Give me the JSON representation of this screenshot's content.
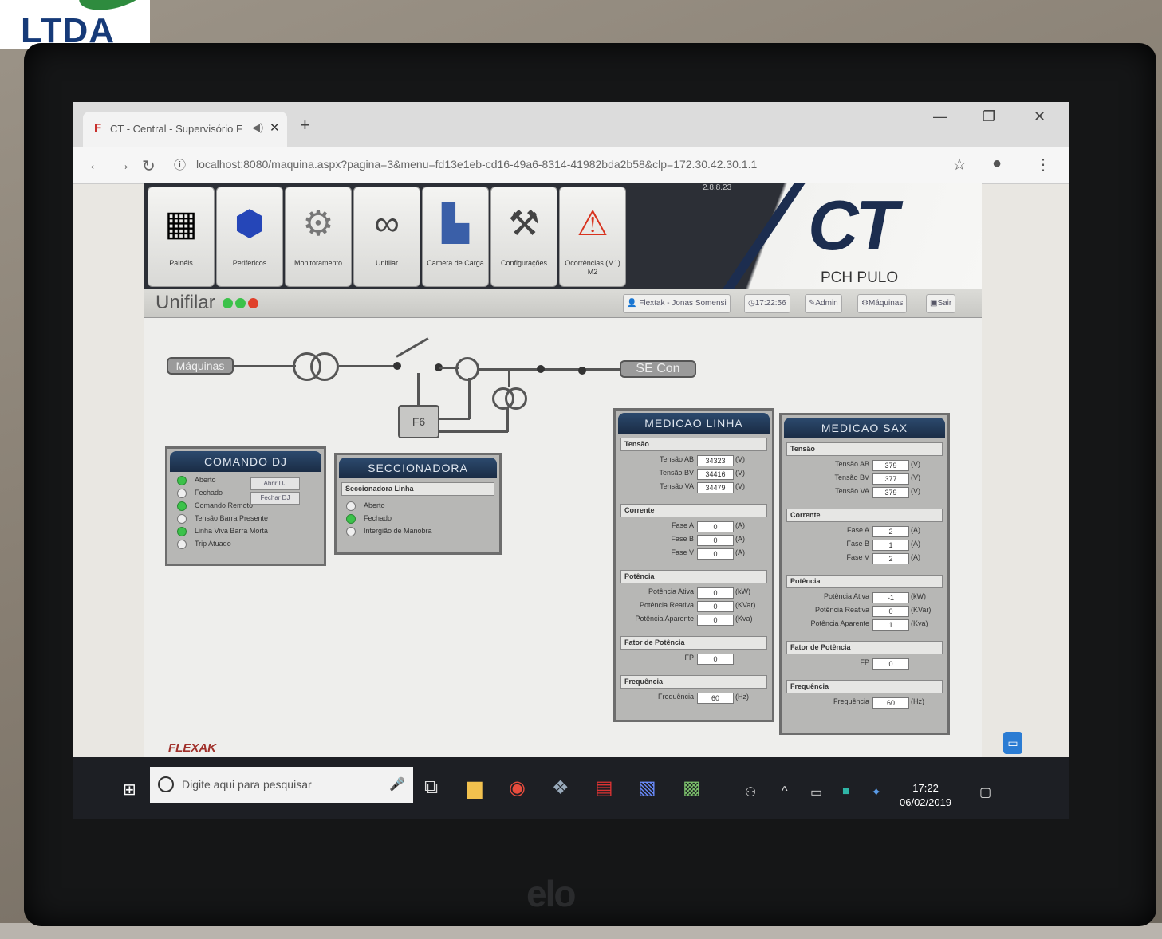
{
  "browser": {
    "tab_title": "CT - Central - Supervisório F",
    "url": "localhost:8080/maquina.aspx?pagina=3&menu=fd13e1eb-cd16-49a6-8314-41982bda2b58&clp=172.30.42.30.1.1"
  },
  "watermark": {
    "text": "LTDA"
  },
  "app": {
    "version": "2.8.8.23",
    "brand": "CT",
    "site": "PCH PULO",
    "page_title": "Unifilar",
    "toolbar": [
      {
        "label": "Painéis",
        "icon": "panel-icon"
      },
      {
        "label": "Periféricos",
        "icon": "pump-icon"
      },
      {
        "label": "Monitoramento",
        "icon": "gear-icon"
      },
      {
        "label": "Unifilar",
        "icon": "transformer-icon"
      },
      {
        "label": "Camera de Carga",
        "icon": "machine-icon"
      },
      {
        "label": "Configurações",
        "icon": "tools-icon"
      },
      {
        "label": "Ocorrências (M1) M2",
        "icon": "alarm-icon"
      }
    ],
    "status_dots": [
      "#3cc24a",
      "#3cc24a",
      "#e0402a"
    ],
    "user": "Flextak - Jonas Somensi",
    "time": "17:22:56",
    "buttons": {
      "admin": "Admin",
      "machines": "Máquinas",
      "exit": "Sair"
    }
  },
  "diagram": {
    "left_label": "Máquinas",
    "right_label": "SE Con",
    "box_label": "F6"
  },
  "comando_dj": {
    "title": "COMANDO DJ",
    "items": [
      {
        "label": "Aberto",
        "on": true
      },
      {
        "label": "Fechado",
        "on": false
      },
      {
        "label": "Comando Remoto",
        "on": true
      },
      {
        "label": "Tensão Barra Presente",
        "on": false
      },
      {
        "label": "Linha Viva Barra Morta",
        "on": true
      },
      {
        "label": "Trip Atuado",
        "on": false
      }
    ],
    "open_btn": "Abrir DJ",
    "close_btn": "Fechar DJ"
  },
  "seccionadora": {
    "title": "SECCIONADORA",
    "section": "Seccionadora Linha",
    "items": [
      {
        "label": "Aberto",
        "on": false
      },
      {
        "label": "Fechado",
        "on": true
      },
      {
        "label": "Intergião de Manobra",
        "on": false
      }
    ]
  },
  "medicao_linha": {
    "title": "MEDICAO LINHA",
    "sections": [
      {
        "name": "Tensão",
        "rows": [
          {
            "label": "Tensão AB",
            "value": "34323",
            "unit": "(V)"
          },
          {
            "label": "Tensão BV",
            "value": "34416",
            "unit": "(V)"
          },
          {
            "label": "Tensão VA",
            "value": "34479",
            "unit": "(V)"
          }
        ]
      },
      {
        "name": "Corrente",
        "rows": [
          {
            "label": "Fase A",
            "value": "0",
            "unit": "(A)"
          },
          {
            "label": "Fase B",
            "value": "0",
            "unit": "(A)"
          },
          {
            "label": "Fase V",
            "value": "0",
            "unit": "(A)"
          }
        ]
      },
      {
        "name": "Potência",
        "rows": [
          {
            "label": "Potência Ativa",
            "value": "0",
            "unit": "(kW)"
          },
          {
            "label": "Potência Reativa",
            "value": "0",
            "unit": "(KVar)"
          },
          {
            "label": "Potência Aparente",
            "value": "0",
            "unit": "(Kva)"
          }
        ]
      },
      {
        "name": "Fator de Potência",
        "rows": [
          {
            "label": "FP",
            "value": "0",
            "unit": ""
          }
        ]
      },
      {
        "name": "Frequência",
        "rows": [
          {
            "label": "Frequência",
            "value": "60",
            "unit": "(Hz)"
          }
        ]
      }
    ]
  },
  "medicao_sax": {
    "title": "MEDICAO SAX",
    "sections": [
      {
        "name": "Tensão",
        "rows": [
          {
            "label": "Tensão AB",
            "value": "379",
            "unit": "(V)"
          },
          {
            "label": "Tensão BV",
            "value": "377",
            "unit": "(V)"
          },
          {
            "label": "Tensão VA",
            "value": "379",
            "unit": "(V)"
          }
        ]
      },
      {
        "name": "Corrente",
        "rows": [
          {
            "label": "Fase A",
            "value": "2",
            "unit": "(A)"
          },
          {
            "label": "Fase B",
            "value": "1",
            "unit": "(A)"
          },
          {
            "label": "Fase V",
            "value": "2",
            "unit": "(A)"
          }
        ]
      },
      {
        "name": "Potência",
        "rows": [
          {
            "label": "Potência Ativa",
            "value": "-1",
            "unit": "(kW)"
          },
          {
            "label": "Potência Reativa",
            "value": "0",
            "unit": "(KVar)"
          },
          {
            "label": "Potência Aparente",
            "value": "1",
            "unit": "(Kva)"
          }
        ]
      },
      {
        "name": "Fator de Potência",
        "rows": [
          {
            "label": "FP",
            "value": "0",
            "unit": ""
          }
        ]
      },
      {
        "name": "Frequência",
        "rows": [
          {
            "label": "Frequência",
            "value": "60",
            "unit": "(Hz)"
          }
        ]
      }
    ]
  },
  "footer_logo": "FLEXAK",
  "taskbar": {
    "search_placeholder": "Digite aqui para pesquisar",
    "time": "17:22",
    "date": "06/02/2019"
  },
  "monitor_brand": "elo"
}
